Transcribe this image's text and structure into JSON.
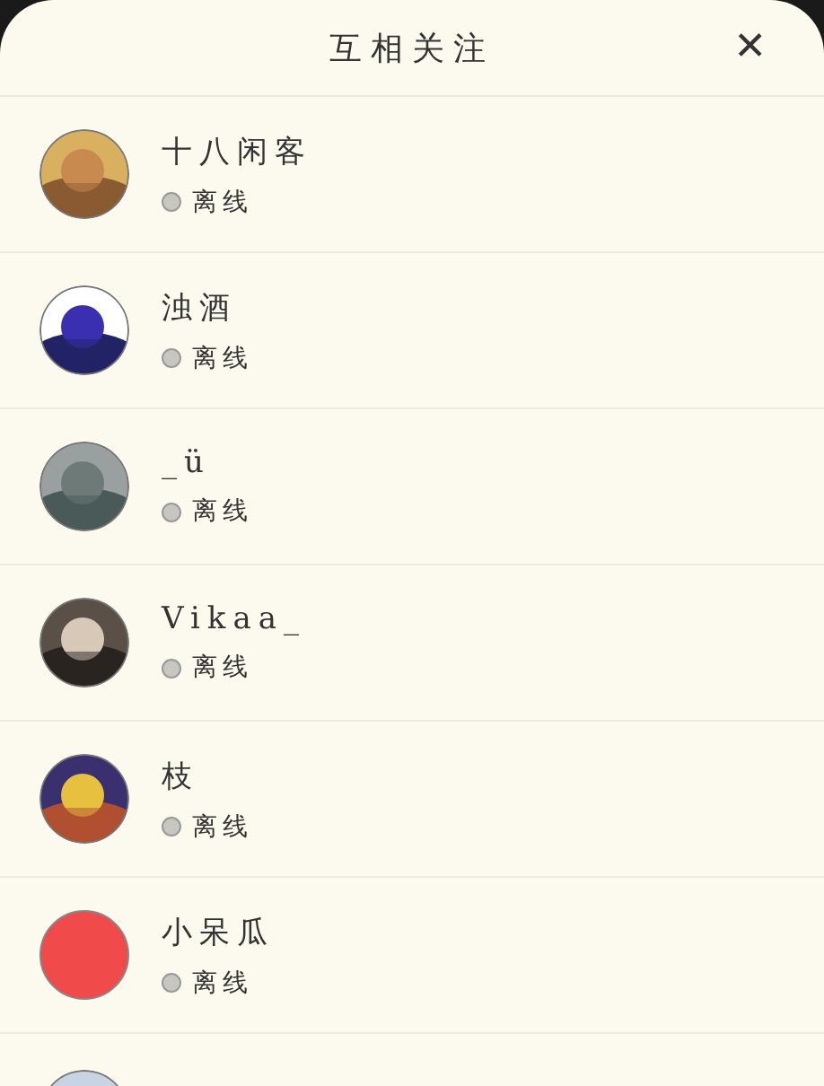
{
  "header": {
    "title": "互相关注",
    "close": "✕"
  },
  "contacts": [
    {
      "kind": "picture",
      "name": "十八闲客",
      "status": "离线",
      "online": false
    },
    {
      "kind": "picture",
      "name": "浊酒",
      "status": "离线",
      "online": false
    },
    {
      "kind": "picture",
      "name": "_ü",
      "status": "离线",
      "online": false
    },
    {
      "kind": "picture",
      "name": "Vikaa_",
      "status": "离线",
      "online": false
    },
    {
      "kind": "picture",
      "name": "枝",
      "status": "离线",
      "online": false
    },
    {
      "kind": "color",
      "color": "#f04a4a",
      "name": "小呆瓜",
      "status": "离线",
      "online": false
    },
    {
      "kind": "partial"
    }
  ]
}
